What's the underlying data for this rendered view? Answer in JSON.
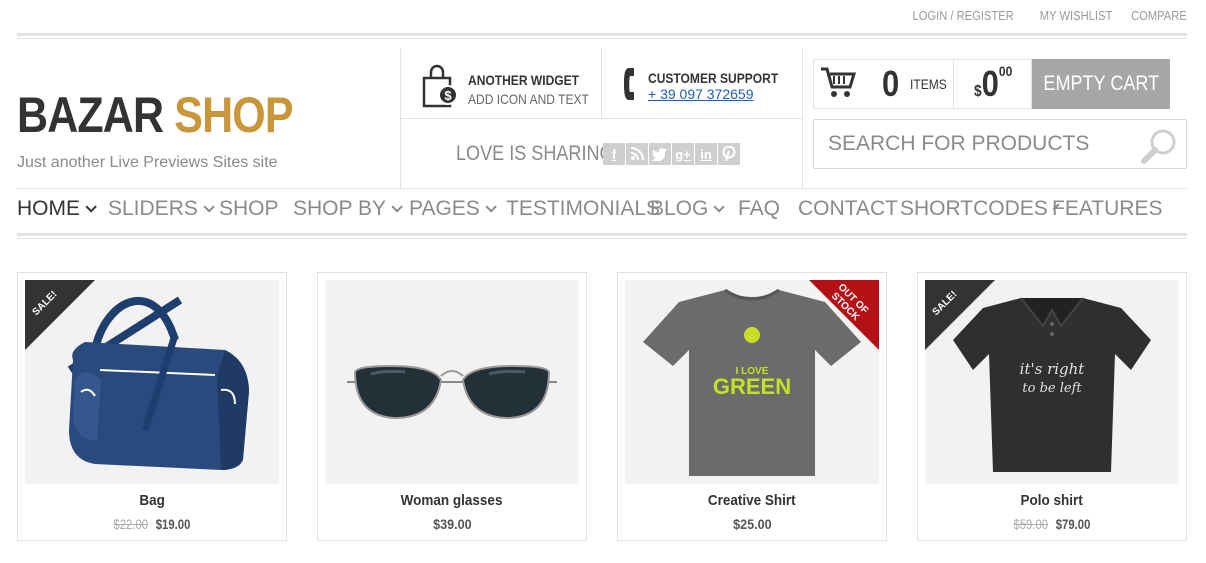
{
  "topbar": {
    "login": "LOGIN / REGISTER",
    "wishlist": "MY WISHLIST",
    "compare": "COMPARE"
  },
  "logo": {
    "part1": "BAZAR",
    "part2": "SHOP",
    "brand_color": "#c9963a"
  },
  "tagline": "Just another Live Previews Sites site",
  "widget": {
    "title": "ANOTHER WIDGET",
    "sub": "ADD ICON AND TEXT",
    "icon": "shopping-bag-dollar-icon"
  },
  "support": {
    "title": "CUSTOMER SUPPORT",
    "phone": "+ 39 097 372659",
    "icon": "phone-icon"
  },
  "sharing": {
    "label": "LOVE IS SHARING",
    "icons": [
      {
        "name": "facebook-icon",
        "glyph": "f"
      },
      {
        "name": "rss-icon",
        "glyph": "⌇"
      },
      {
        "name": "twitter-icon",
        "glyph": "t"
      },
      {
        "name": "google-plus-icon",
        "glyph": "g+"
      },
      {
        "name": "linkedin-icon",
        "glyph": "in"
      },
      {
        "name": "pinterest-icon",
        "glyph": "p"
      }
    ]
  },
  "cart": {
    "count": "0",
    "items_label": "ITEMS",
    "currency": "$",
    "total_int": "0",
    "total_dec": "00",
    "empty_label": "EMPTY CART"
  },
  "search": {
    "placeholder": "SEARCH FOR PRODUCTS"
  },
  "nav": [
    {
      "label": "HOME",
      "dropdown": true,
      "active": true
    },
    {
      "label": "SLIDERS",
      "dropdown": true
    },
    {
      "label": "SHOP",
      "dropdown": false
    },
    {
      "label": "SHOP BY",
      "dropdown": true
    },
    {
      "label": "PAGES",
      "dropdown": true
    },
    {
      "label": "TESTIMONIALS",
      "dropdown": false
    },
    {
      "label": "BLOG",
      "dropdown": true
    },
    {
      "label": "FAQ",
      "dropdown": false
    },
    {
      "label": "CONTACT",
      "dropdown": false
    },
    {
      "label": "SHORTCODES",
      "dropdown": true
    },
    {
      "label": "FEATURES",
      "dropdown": false
    }
  ],
  "products": [
    {
      "name": "Bag",
      "old_price": "$22.00",
      "price": "$19.00",
      "badge": "SALE!"
    },
    {
      "name": "Woman glasses",
      "old_price": "",
      "price": "$39.00",
      "badge": ""
    },
    {
      "name": "Creative Shirt",
      "old_price": "",
      "price": "$25.00",
      "badge": "OUT OF STOCK",
      "shirt_text_1": "I LOVE",
      "shirt_text_2": "GREEN"
    },
    {
      "name": "Polo shirt",
      "old_price": "$59.00",
      "price": "$79.00",
      "badge": "SALE!",
      "shirt_text_1": "it's right",
      "shirt_text_2": "to be left"
    }
  ]
}
